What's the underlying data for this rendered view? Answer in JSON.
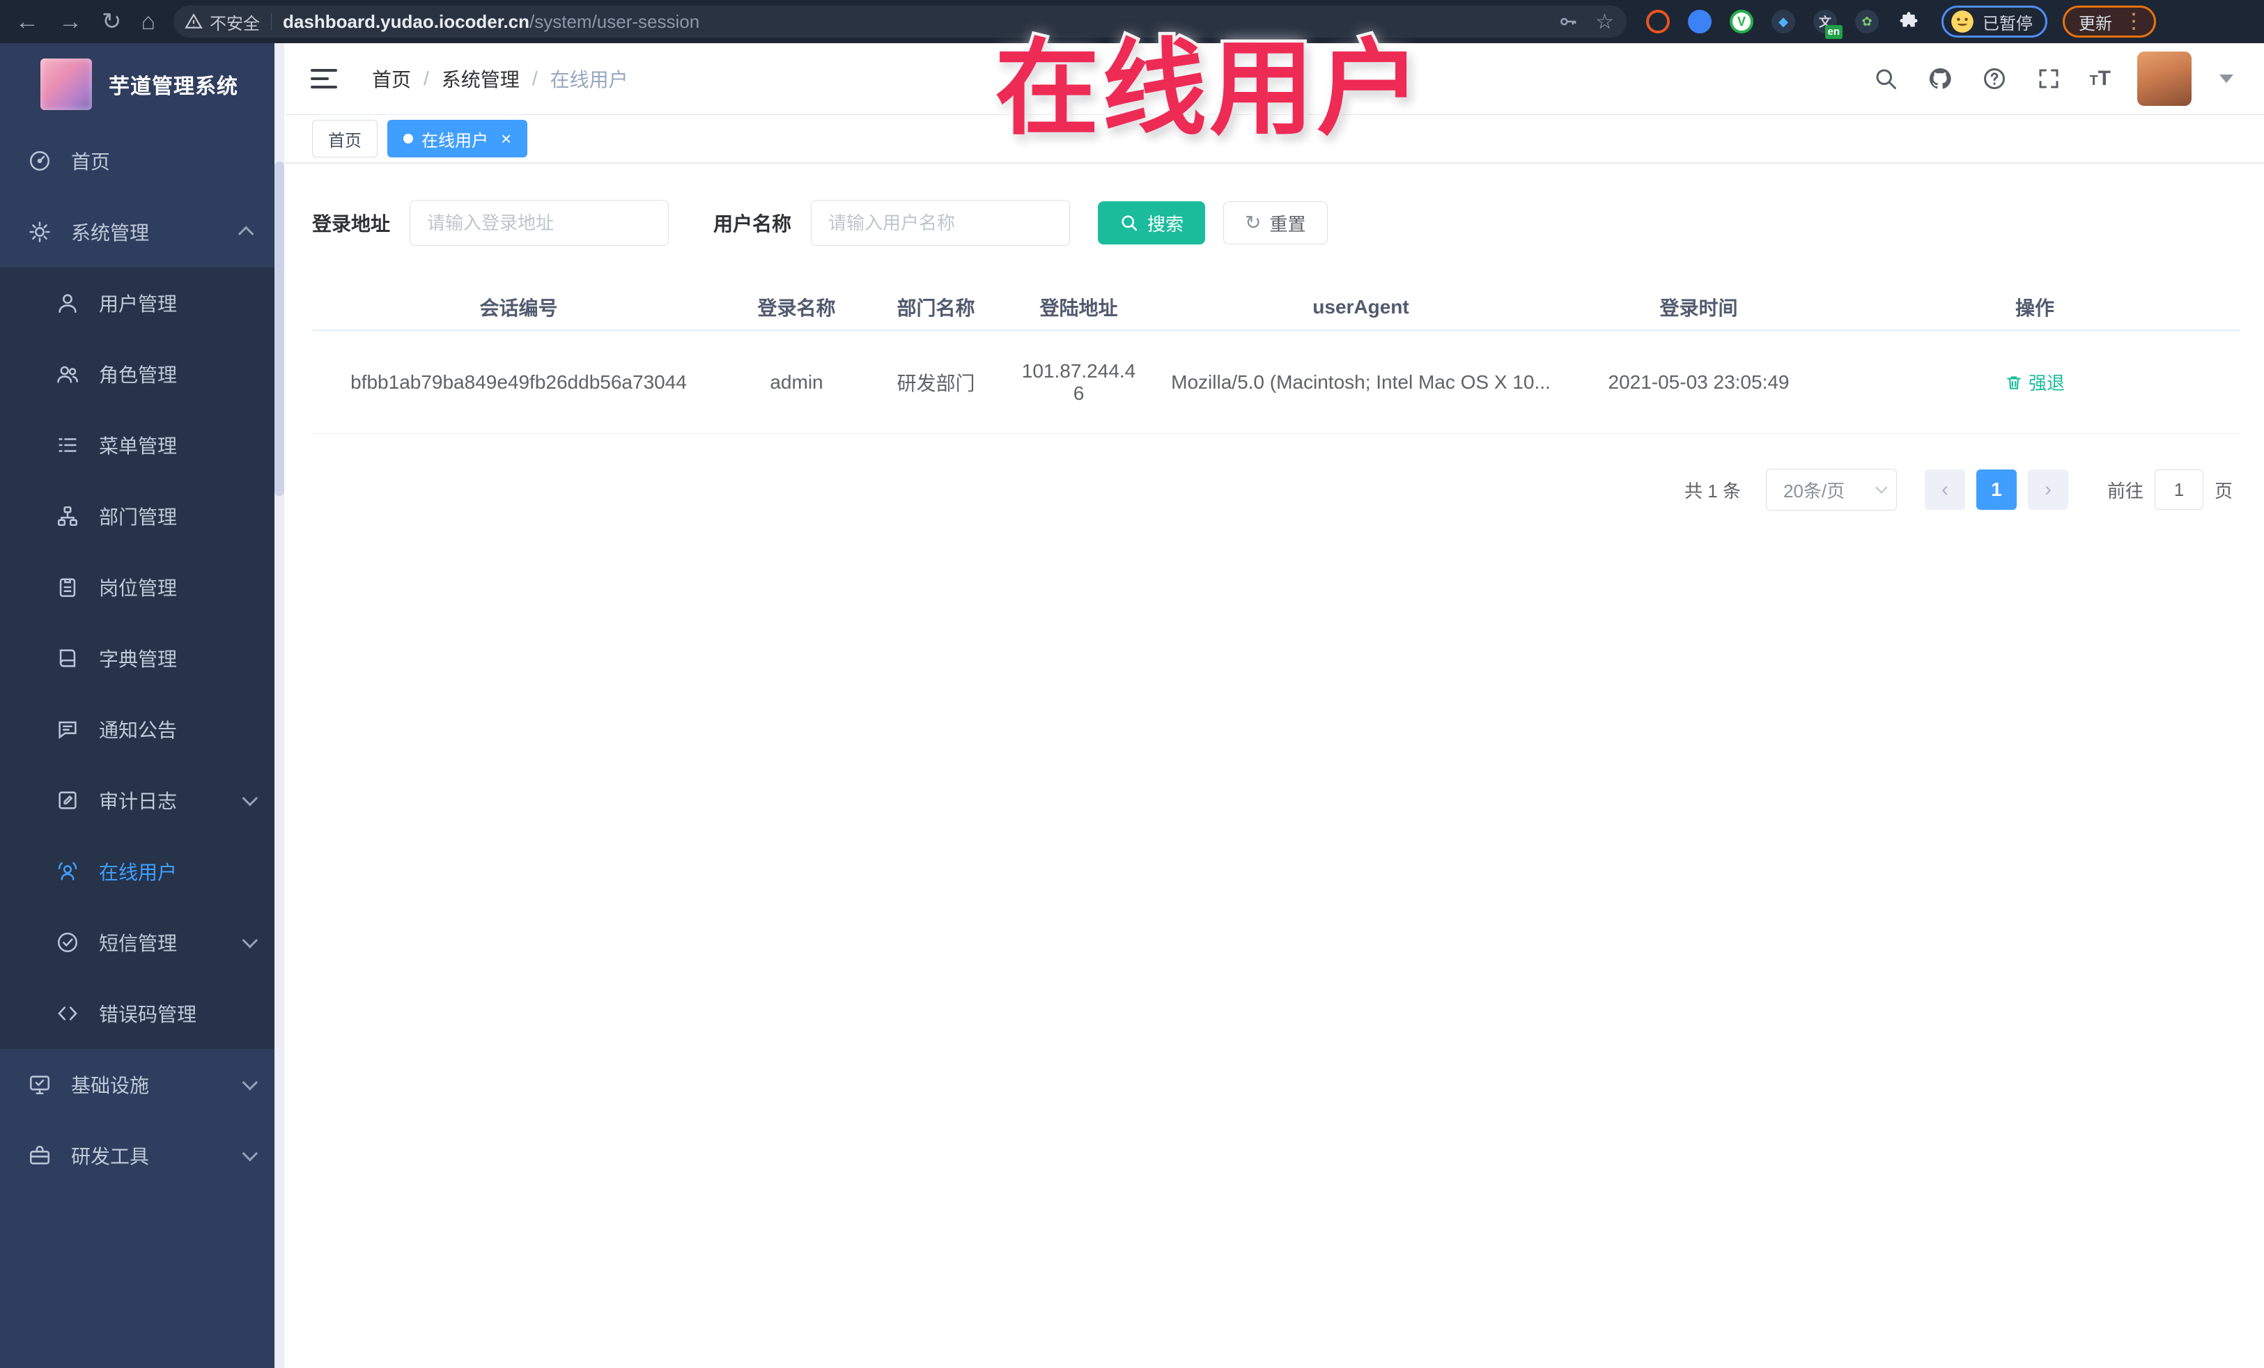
{
  "browser": {
    "security_label": "不安全",
    "url_host": "dashboard.yudao.iocoder.cn",
    "url_path": "/system/user-session",
    "profile_badge": "已暂停",
    "update_button": "更新",
    "translate_badge": "en"
  },
  "overlay": {
    "annotation": "在线用户"
  },
  "sidebar": {
    "app_title": "芋道管理系统",
    "items": [
      {
        "label": "首页"
      },
      {
        "label": "系统管理"
      },
      {
        "label": "用户管理"
      },
      {
        "label": "角色管理"
      },
      {
        "label": "菜单管理"
      },
      {
        "label": "部门管理"
      },
      {
        "label": "岗位管理"
      },
      {
        "label": "字典管理"
      },
      {
        "label": "通知公告"
      },
      {
        "label": "审计日志"
      },
      {
        "label": "在线用户"
      },
      {
        "label": "短信管理"
      },
      {
        "label": "错误码管理"
      },
      {
        "label": "基础设施"
      },
      {
        "label": "研发工具"
      }
    ]
  },
  "breadcrumb": {
    "items": [
      "首页",
      "系统管理",
      "在线用户"
    ]
  },
  "tabs": [
    {
      "label": "首页",
      "active": false
    },
    {
      "label": "在线用户",
      "active": true
    }
  ],
  "filters": {
    "login_address_label": "登录地址",
    "login_address_placeholder": "请输入登录地址",
    "username_label": "用户名称",
    "username_placeholder": "请输入用户名称",
    "search_label": "搜索",
    "reset_label": "重置"
  },
  "table": {
    "columns": [
      "会话编号",
      "登录名称",
      "部门名称",
      "登陆地址",
      "userAgent",
      "登录时间",
      "操作"
    ],
    "rows": [
      {
        "session_id": "bfbb1ab79ba849e49fb26ddb56a73044",
        "username": "admin",
        "dept": "研发部门",
        "ip": "101.87.244.46",
        "user_agent": "Mozilla/5.0 (Macintosh; Intel Mac OS X 10...",
        "login_time": "2021-05-03 23:05:49",
        "action": "强退"
      }
    ]
  },
  "pagination": {
    "total_label": "共 1 条",
    "page_size": "20条/页",
    "current_page": "1",
    "goto_label": "前往",
    "goto_value": "1",
    "page_unit": "页"
  },
  "colors": {
    "accent_blue": "#409eff",
    "accent_teal": "#1abc9c",
    "sidebar_bg": "#2f3d5e",
    "submenu_bg": "#263349",
    "annotation_red": "#ee2b55",
    "browser_bar": "#1d2634"
  }
}
